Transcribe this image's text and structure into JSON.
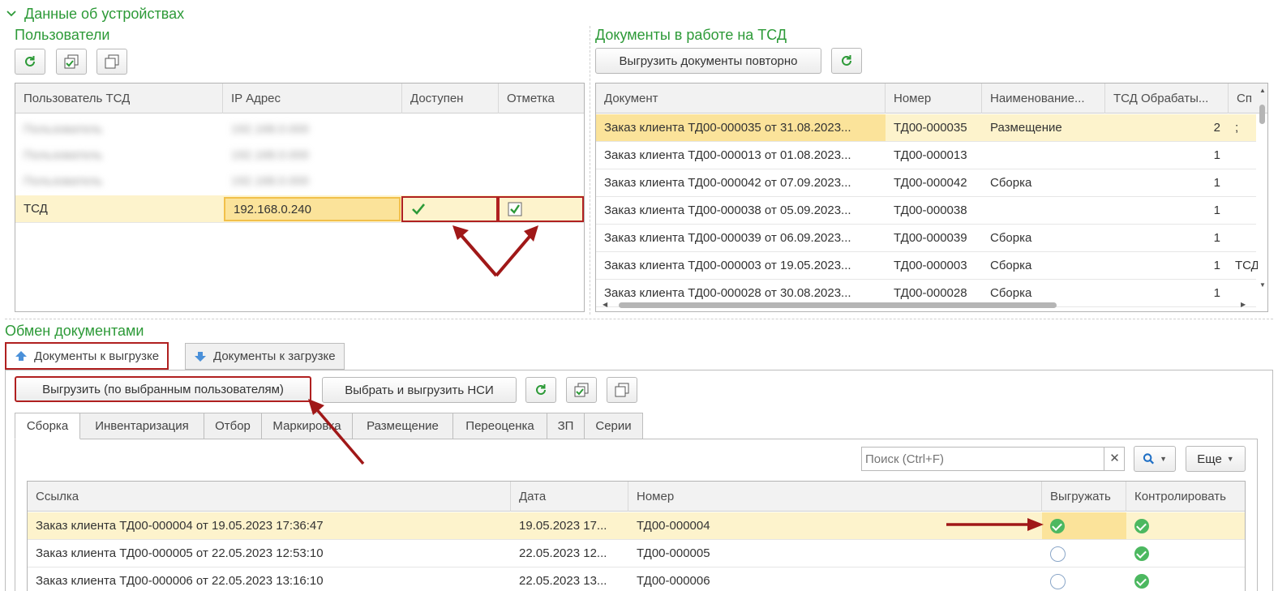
{
  "section_title": "Данные об устройствах",
  "users": {
    "title": "Пользователи",
    "columns": [
      "Пользователь ТСД",
      "IP Адрес",
      "Доступен",
      "Отметка"
    ],
    "blurred_rows": [
      {
        "user": "Пользователь",
        "ip": "192.168.0.000"
      },
      {
        "user": "Пользователь",
        "ip": "192.168.0.000"
      },
      {
        "user": "Пользователь",
        "ip": "192.168.0.000"
      }
    ],
    "selected_row": {
      "user": "ТСД",
      "ip": "192.168.0.240",
      "available": true,
      "marked": true
    }
  },
  "docs_in_work": {
    "title": "Документы в работе на ТСД",
    "reload_button": "Выгрузить документы повторно",
    "columns": [
      "Документ",
      "Номер",
      "Наименование...",
      "ТСД Обрабаты...",
      "Сп"
    ],
    "rows": [
      {
        "doc": "Заказ клиента ТД00-000035 от 31.08.2023...",
        "num": "ТД00-000035",
        "name": "Размещение",
        "count": "2",
        "extra": ";"
      },
      {
        "doc": "Заказ клиента ТД00-000013 от 01.08.2023...",
        "num": "ТД00-000013",
        "name": "",
        "count": "1",
        "extra": ""
      },
      {
        "doc": "Заказ клиента ТД00-000042 от 07.09.2023...",
        "num": "ТД00-000042",
        "name": "Сборка",
        "count": "1",
        "extra": ""
      },
      {
        "doc": "Заказ клиента ТД00-000038 от 05.09.2023...",
        "num": "ТД00-000038",
        "name": "",
        "count": "1",
        "extra": ""
      },
      {
        "doc": "Заказ клиента ТД00-000039 от 06.09.2023...",
        "num": "ТД00-000039",
        "name": "Сборка",
        "count": "1",
        "extra": ""
      },
      {
        "doc": "Заказ клиента ТД00-000003 от 19.05.2023...",
        "num": "ТД00-000003",
        "name": "Сборка",
        "count": "1",
        "extra": "ТСД"
      },
      {
        "doc": "Заказ клиента ТД00-000028 от 30.08.2023...",
        "num": "ТД00-000028",
        "name": "Сборка",
        "count": "1",
        "extra": ""
      }
    ]
  },
  "exchange": {
    "title": "Обмен документами",
    "tab_upload": "Документы к выгрузке",
    "tab_download": "Документы к загрузке",
    "btn_upload_selected": "Выгрузить (по выбранным пользователям)",
    "btn_select_nsi": "Выбрать и выгрузить НСИ",
    "subtabs": [
      "Сборка",
      "Инвентаризация",
      "Отбор",
      "Маркировка",
      "Размещение",
      "Переоценка",
      "ЗП",
      "Серии"
    ],
    "search_placeholder": "Поиск (Ctrl+F)",
    "more_button": "Еще",
    "columns": [
      "Ссылка",
      "Дата",
      "Номер",
      "Выгружать",
      "Контролировать"
    ],
    "rows": [
      {
        "ref": "Заказ клиента ТД00-000004 от 19.05.2023 17:36:47",
        "date": "19.05.2023 17...",
        "num": "ТД00-000004",
        "upload": true,
        "control": true
      },
      {
        "ref": "Заказ клиента ТД00-000005 от 22.05.2023 12:53:10",
        "date": "22.05.2023 12...",
        "num": "ТД00-000005",
        "upload": false,
        "control": true
      },
      {
        "ref": "Заказ клиента ТД00-000006 от 22.05.2023 13:16:10",
        "date": "22.05.2023 13...",
        "num": "ТД00-000006",
        "upload": false,
        "control": true
      }
    ]
  },
  "colors": {
    "accent_green": "#2d9a38",
    "selection": "#fdf3cc",
    "annotation_red": "#a01818"
  }
}
